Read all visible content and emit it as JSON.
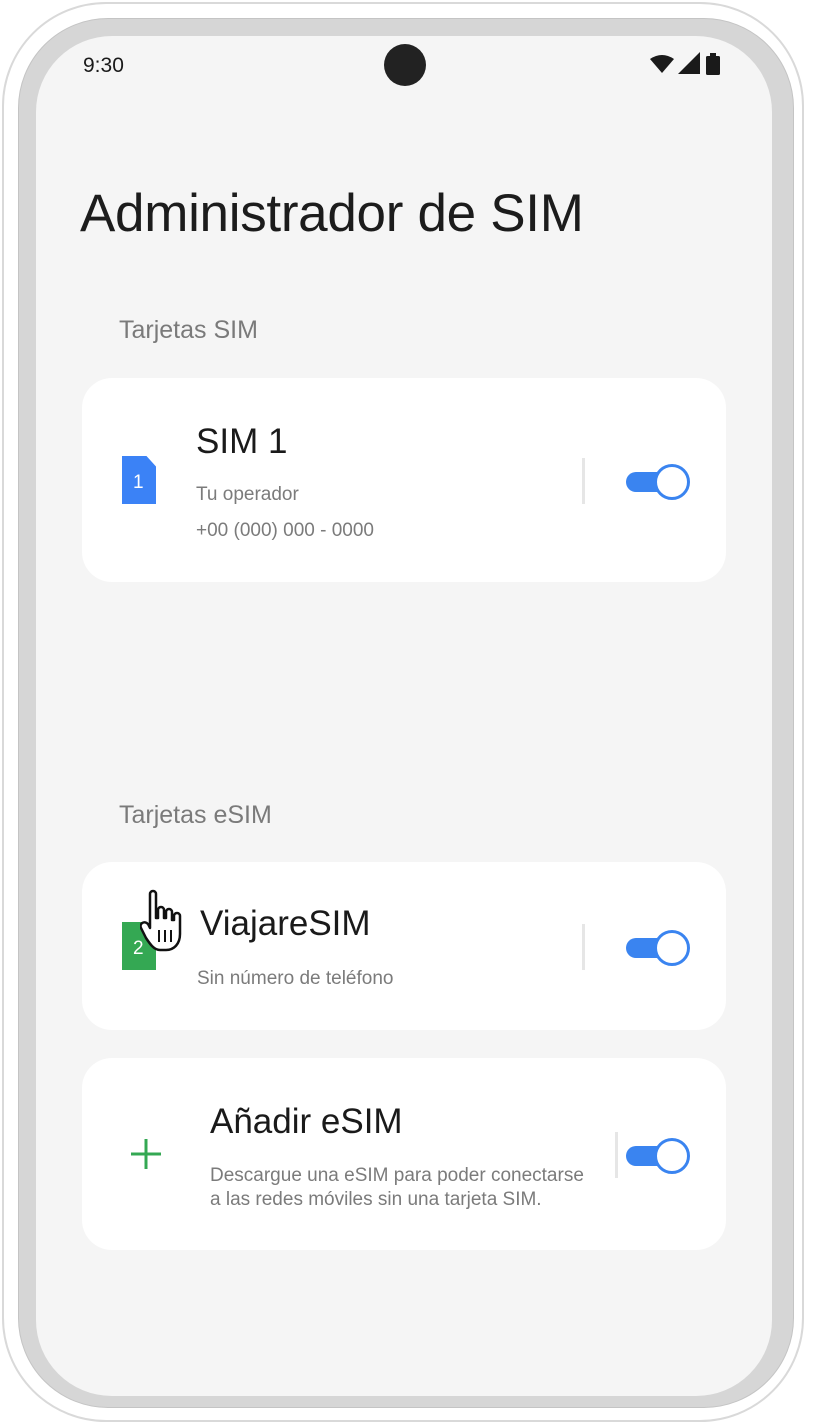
{
  "status_bar": {
    "time": "9:30",
    "icons": [
      "wifi-icon",
      "signal-icon",
      "battery-icon"
    ]
  },
  "page": {
    "title": "Administrador de SIM"
  },
  "sections": {
    "sim_label": "Tarjetas SIM",
    "esim_label": "Tarjetas eSIM"
  },
  "sim1": {
    "slot": "1",
    "name": "SIM 1",
    "operator": "Tu operador",
    "phone": "+00 (000) 000 - 0000",
    "enabled": true,
    "chip_color": "#3b82f6"
  },
  "esim1": {
    "slot": "2",
    "name": "ViajareSIM",
    "phone": "Sin número de teléfono",
    "enabled": true,
    "chip_color": "#34a853"
  },
  "add_esim": {
    "title": "Añadir eSIM",
    "description_line1": "Descargue una eSIM para poder conectarse",
    "description_line2": "a las redes móviles sin una tarjeta SIM.",
    "enabled": true,
    "icon": "plus-icon",
    "icon_color": "#34a853"
  },
  "colors": {
    "accent": "#3a84f0",
    "background": "#f5f5f5",
    "card": "#ffffff"
  }
}
